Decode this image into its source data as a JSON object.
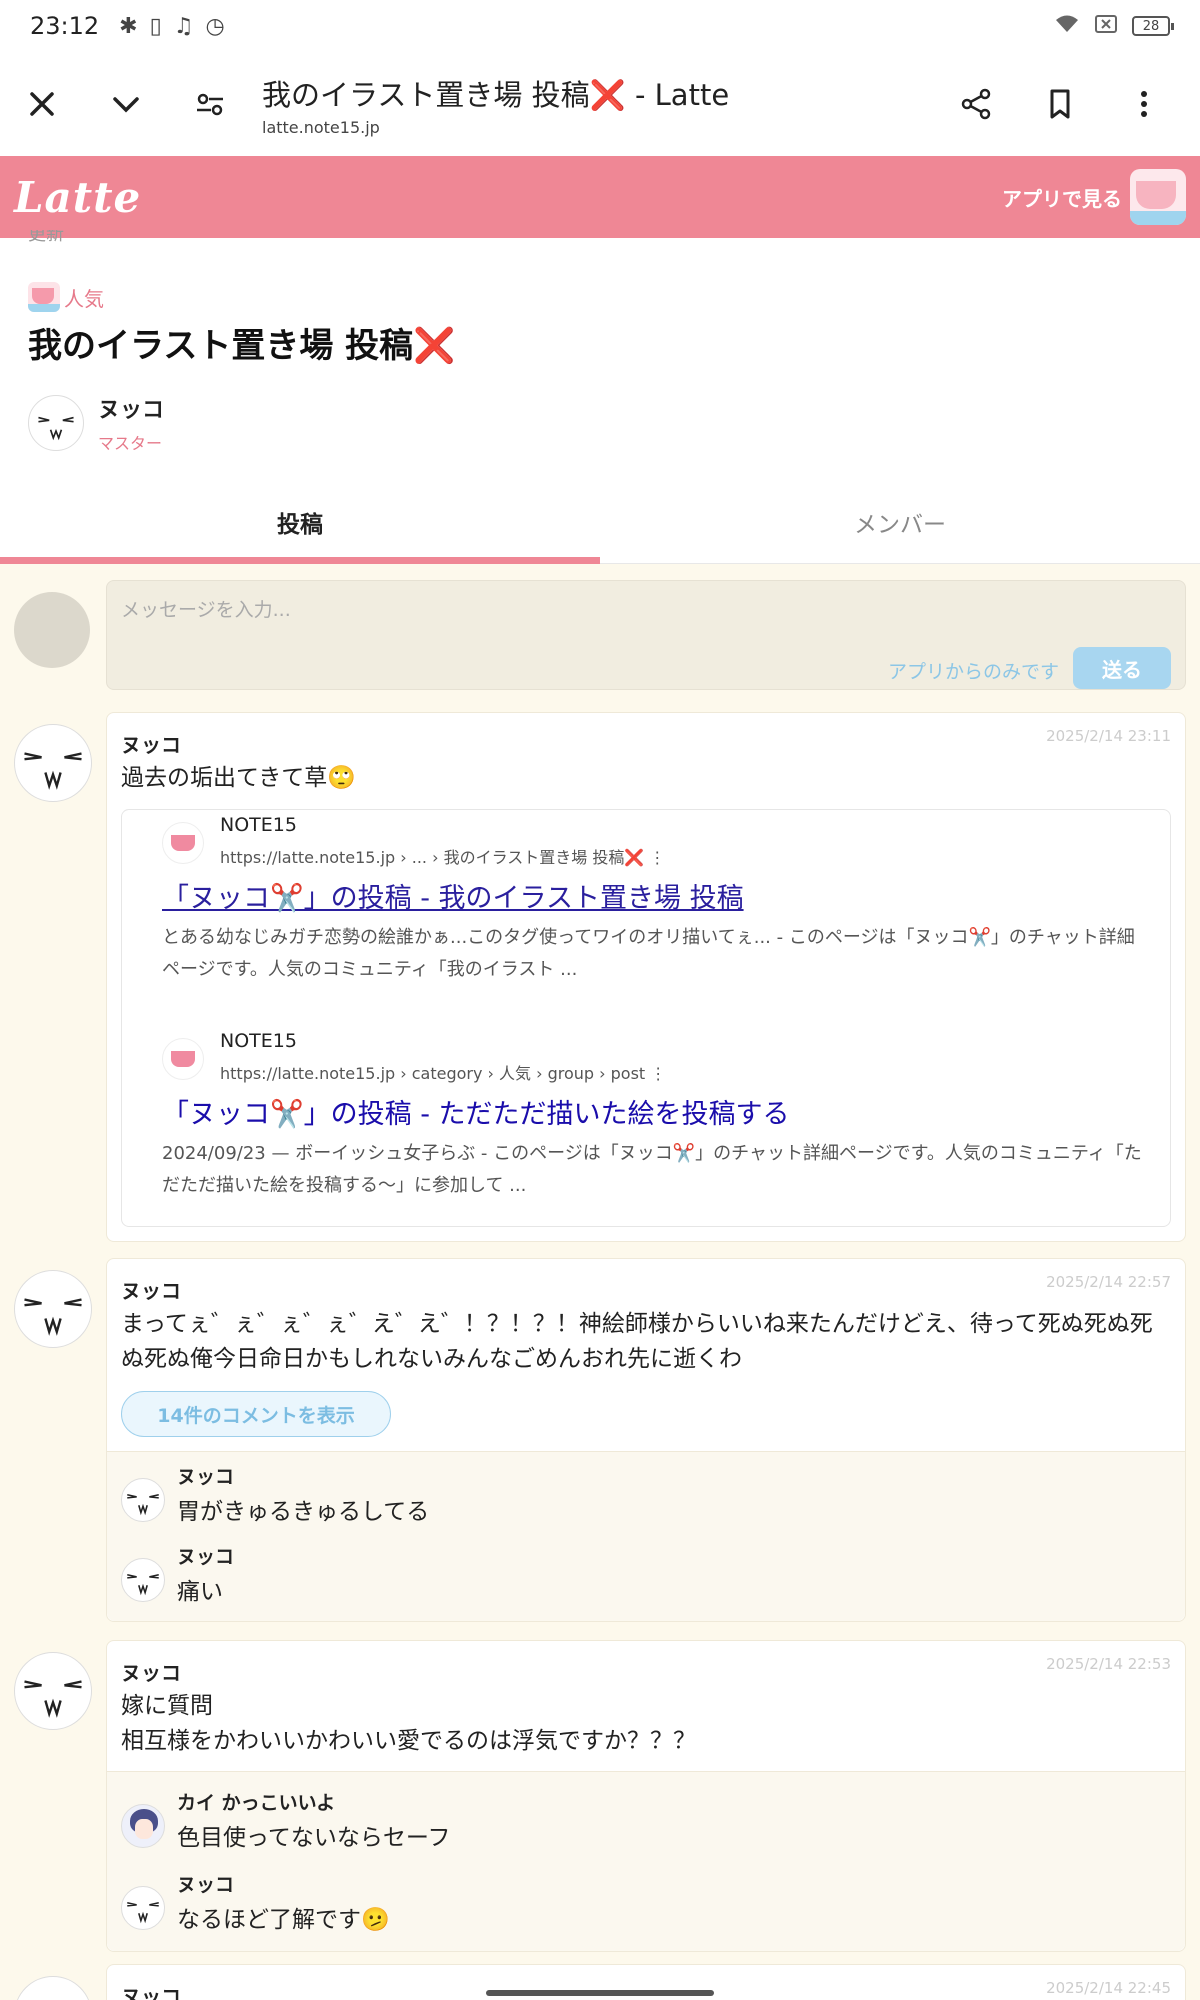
{
  "status_bar": {
    "time": "23:12",
    "battery": "28"
  },
  "browser": {
    "title": "我のイラスト置き場 投稿❌ - Latte",
    "url": "latte.note15.jp"
  },
  "latte_header": {
    "logo": "Latte",
    "app_link": "アプリで見る"
  },
  "community": {
    "cut_text": "更新",
    "tag": "人気",
    "title": "我のイラスト置き場 投稿",
    "title_mark": "❌",
    "owner_name": "ヌッコ",
    "owner_role": "マスター"
  },
  "tabs": [
    {
      "label": "投稿",
      "active": true
    },
    {
      "label": "メンバー",
      "active": false
    }
  ],
  "composer": {
    "placeholder": "メッセージを入力...",
    "notice": "アプリからのみです",
    "send_label": "送る"
  },
  "posts": [
    {
      "author": "ヌッコ",
      "date": "2025/2/14 23:11",
      "body": "過去の垢出てきて草🙄",
      "embed": [
        {
          "site": "NOTE15",
          "url": "https://latte.note15.jp › ... › 我のイラスト置き場 投稿❌  ⋮",
          "title": "「ヌッコ✂️」の投稿 - 我のイラスト置き場 投稿",
          "snippet": "とある幼なじみガチ恋勢の絵誰かぁ...このタグ使ってワイのオリ描いてぇ... - このページは「ヌッコ✂️」のチャット詳細ページです。人気のコミュニティ「我のイラスト ..."
        },
        {
          "site": "NOTE15",
          "url": "https://latte.note15.jp › category › 人気 › group › post  ⋮",
          "title": "「ヌッコ✂️」の投稿 - ただただ描いた絵を投稿する",
          "snippet": "2024/09/23 — ボーイッシュ女子らぶ - このページは「ヌッコ✂️」のチャット詳細ページです。人気のコミュニティ「ただただ描いた絵を投稿する〜」に参加して ..."
        }
      ]
    },
    {
      "author": "ヌッコ",
      "date": "2025/2/14 22:57",
      "body": "まってぇ゛ぇ゛ぇ゛ぇ゛え゛え゛！？！？！神絵師様からいいね来たんだけどえ、待って死ぬ死ぬ死ぬ死ぬ俺今日命日かもしれないみんなごめんおれ先に逝くわ",
      "more_comments": "14件のコメントを表示",
      "replies": [
        {
          "name": "ヌッコ",
          "text": "胃がきゅるきゅるしてる"
        },
        {
          "name": "ヌッコ",
          "text": "痛い"
        }
      ]
    },
    {
      "author": "ヌッコ",
      "date": "2025/2/14 22:53",
      "body_lines": [
        "嫁に質問",
        "相互様をかわいいかわいい愛でるのは浮気ですか？？？"
      ],
      "replies": [
        {
          "name": "カイ かっこいいよ",
          "text": "色目使ってないならセーフ"
        },
        {
          "name": "ヌッコ",
          "text": "なるほど了解です🫤"
        }
      ]
    },
    {
      "author": "ヌッコ",
      "date": "2025/2/14 22:45"
    }
  ]
}
